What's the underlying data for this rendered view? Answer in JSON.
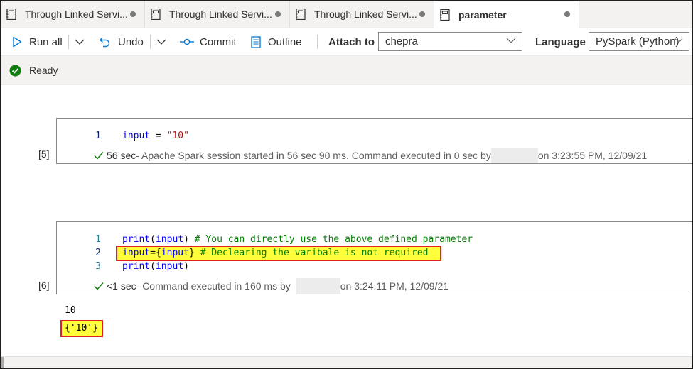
{
  "tabs": [
    {
      "label": "Through Linked Servi...",
      "modified": true,
      "active": false
    },
    {
      "label": "Through Linked Servi...",
      "modified": true,
      "active": false
    },
    {
      "label": "Through Linked Servi...",
      "modified": true,
      "active": false
    },
    {
      "label": "parameter",
      "modified": true,
      "active": true
    }
  ],
  "toolbar": {
    "run_all": "Run all",
    "undo": "Undo",
    "commit": "Commit",
    "outline": "Outline",
    "attach_label": "Attach to",
    "attach_value": "chepra",
    "language_label": "Language",
    "language_value": "PySpark (Python)"
  },
  "status": {
    "text": "Ready"
  },
  "cells": [
    {
      "exec_count": "[5]",
      "lines": [
        {
          "num": "1",
          "parts": [
            [
              "kw",
              "input"
            ],
            [
              "plain",
              " = "
            ],
            [
              "str",
              "\"10\""
            ]
          ]
        }
      ],
      "exec_time": "56 sec",
      "exec_msg_a": " - Apache Spark session started in 56 sec 90 ms. Command executed in 0 sec by",
      "exec_msg_b": "on 3:23:55 PM, 12/09/21"
    },
    {
      "exec_count": "[6]",
      "lines": [
        {
          "num": "1",
          "parts": [
            [
              "kw",
              "print"
            ],
            [
              "plain",
              "("
            ],
            [
              "kw",
              "input"
            ],
            [
              "plain",
              ")"
            ],
            [
              "cm",
              " # You can directly use the above defined parameter"
            ]
          ]
        },
        {
          "num": "2",
          "parts": [
            [
              "kw",
              "input"
            ],
            [
              "plain",
              "={"
            ],
            [
              "kw",
              "input"
            ],
            [
              "plain",
              "}"
            ],
            [
              "cm",
              " # Declearing the varibale is not required"
            ]
          ]
        },
        {
          "num": "3",
          "parts": [
            [
              "kw",
              "print"
            ],
            [
              "plain",
              "("
            ],
            [
              "kw",
              "input"
            ],
            [
              "plain",
              ")"
            ]
          ]
        }
      ],
      "exec_time": "<1 sec",
      "exec_msg_a": " - Command executed in 160 ms by",
      "exec_msg_b": "on 3:24:11 PM, 12/09/21",
      "output": [
        "10",
        "{'10'}"
      ]
    }
  ],
  "colors": {
    "accent": "#0078d4",
    "ready": "#107c10",
    "highlight": "#ffff3b",
    "highlight_border": "#e02020"
  }
}
